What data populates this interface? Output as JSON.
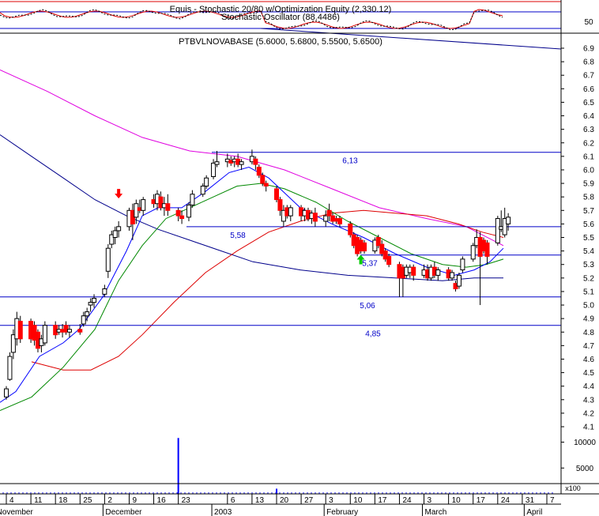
{
  "colors": {
    "background": "#ffffff",
    "axis": "#000000",
    "level_line": "#0000c8",
    "level_label": "#0000c8",
    "price_line": "#00008b",
    "ma_magenta": "#e000e0",
    "ma_red": "#dd0000",
    "ma_green": "#008800",
    "ma_blue": "#0000ff",
    "candle_up": "#ffffff",
    "candle_down": "#ff0000",
    "signal_sell": "#ff0000",
    "signal_buy": "#00cc00",
    "volume": "#0000ff"
  },
  "stochastic_panel": {
    "title_line1": "Equis - Stochastic 20/80  w/Optimization Equity (2,330.12)",
    "title_line2": "Stochastic Oscillator (88.4486)",
    "axis_label": "50"
  },
  "price_panel": {
    "title": "PTBVLNOVABASE (5.6000, 5.6800, 5.5500, 5.6500)",
    "y_ticks": [
      "6.9",
      "6.8",
      "6.7",
      "6.6",
      "6.5",
      "6.4",
      "6.3",
      "6.2",
      "6.1",
      "6.0",
      "5.9",
      "5.8",
      "5.7",
      "5.6",
      "5.5",
      "5.4",
      "5.3",
      "5.2",
      "5.1",
      "5.0",
      "4.9",
      "4.8",
      "4.7",
      "4.6",
      "4.5",
      "4.4",
      "4.3",
      "4.2",
      "4.1"
    ]
  },
  "volume_panel": {
    "y_ticks": [
      "10000",
      "5000"
    ],
    "multiplier_label": "x100"
  },
  "x_axis": {
    "day_ticks": [
      "4",
      "11",
      "18",
      "25",
      "2",
      "9",
      "16",
      "23",
      "6",
      "13",
      "20",
      "27",
      "3",
      "10",
      "17",
      "24",
      "3",
      "10",
      "17",
      "24",
      "31",
      "7"
    ],
    "month_labels": [
      "November",
      "December",
      "2003",
      "February",
      "March",
      "April"
    ]
  },
  "chart_data": {
    "type": "line",
    "title": "PTBVLNOVABASE (5.6000, 5.6800, 5.5500, 5.6500)",
    "ylim": [
      4.1,
      6.9
    ],
    "grid": false,
    "levels": [
      {
        "label": "6,13",
        "value": 6.13
      },
      {
        "label": "5,58",
        "value": 5.58
      },
      {
        "label": "5,37",
        "value": 5.37
      },
      {
        "label": "5,06",
        "value": 5.06
      },
      {
        "label": "4,85",
        "value": 4.85
      }
    ],
    "candles": [
      {
        "date": "2002-11-01",
        "open": 4.28,
        "high": 4.32,
        "low": 4.22,
        "close": 4.3
      },
      {
        "date": "2002-11-04",
        "open": 4.32,
        "high": 4.4,
        "low": 4.3,
        "close": 4.38
      },
      {
        "date": "2002-11-05",
        "open": 4.45,
        "high": 4.65,
        "low": 4.44,
        "close": 4.62
      },
      {
        "date": "2002-11-06",
        "open": 4.65,
        "high": 4.82,
        "low": 4.6,
        "close": 4.78
      },
      {
        "date": "2002-11-07",
        "open": 4.75,
        "high": 4.95,
        "low": 4.7,
        "close": 4.9
      },
      {
        "date": "2002-11-08",
        "open": 4.88,
        "high": 4.92,
        "low": 4.72,
        "close": 4.75
      },
      {
        "date": "2002-11-11",
        "open": 4.88,
        "high": 4.9,
        "low": 4.72,
        "close": 4.75
      },
      {
        "date": "2002-11-12",
        "open": 4.85,
        "high": 4.88,
        "low": 4.7,
        "close": 4.74
      },
      {
        "date": "2002-11-13",
        "open": 4.8,
        "high": 4.82,
        "low": 4.65,
        "close": 4.68
      },
      {
        "date": "2002-11-14",
        "open": 4.7,
        "high": 4.78,
        "low": 4.65,
        "close": 4.75
      },
      {
        "date": "2002-11-15",
        "open": 4.72,
        "high": 4.88,
        "low": 4.7,
        "close": 4.85
      },
      {
        "date": "2002-11-18",
        "open": 4.85,
        "high": 4.88,
        "low": 4.75,
        "close": 4.78
      },
      {
        "date": "2002-11-19",
        "open": 4.8,
        "high": 4.85,
        "low": 4.78,
        "close": 4.82
      },
      {
        "date": "2002-11-20",
        "open": 4.82,
        "high": 4.86,
        "low": 4.76,
        "close": 4.8
      },
      {
        "date": "2002-11-21",
        "open": 4.85,
        "high": 4.88,
        "low": 4.78,
        "close": 4.8
      },
      {
        "date": "2002-11-22",
        "open": 4.8,
        "high": 4.85,
        "low": 4.76,
        "close": 4.82
      },
      {
        "date": "2002-11-25",
        "open": 4.82,
        "high": 4.86,
        "low": 4.78,
        "close": 4.8
      },
      {
        "date": "2002-11-26",
        "open": 4.86,
        "high": 4.95,
        "low": 4.84,
        "close": 4.92
      },
      {
        "date": "2002-11-27",
        "open": 4.92,
        "high": 4.98,
        "low": 4.88,
        "close": 4.95
      },
      {
        "date": "2002-11-28",
        "open": 5.0,
        "high": 5.05,
        "low": 4.95,
        "close": 5.02
      },
      {
        "date": "2002-11-29",
        "open": 5.02,
        "high": 5.08,
        "low": 4.98,
        "close": 5.05
      },
      {
        "date": "2002-12-02",
        "open": 5.08,
        "high": 5.15,
        "low": 5.06,
        "close": 5.12
      },
      {
        "date": "2002-12-03",
        "open": 5.25,
        "high": 5.45,
        "low": 5.2,
        "close": 5.42
      },
      {
        "date": "2002-12-04",
        "open": 5.45,
        "high": 5.55,
        "low": 5.42,
        "close": 5.52
      },
      {
        "date": "2002-12-05",
        "open": 5.5,
        "high": 5.58,
        "low": 5.45,
        "close": 5.55
      },
      {
        "date": "2002-12-06",
        "open": 5.55,
        "high": 5.62,
        "low": 5.5,
        "close": 5.58
      },
      {
        "date": "2002-12-09",
        "open": 5.58,
        "high": 5.72,
        "low": 5.55,
        "close": 5.7
      },
      {
        "date": "2002-12-10",
        "open": 5.7,
        "high": 5.75,
        "low": 5.48,
        "close": 5.6
      },
      {
        "date": "2002-12-11",
        "open": 5.65,
        "high": 5.78,
        "low": 5.6,
        "close": 5.75
      },
      {
        "date": "2002-12-12",
        "open": 5.72,
        "high": 5.78,
        "low": 5.68,
        "close": 5.7
      },
      {
        "date": "2002-12-13",
        "open": 5.7,
        "high": 5.8,
        "low": 5.66,
        "close": 5.78
      },
      {
        "date": "2002-12-16",
        "open": 5.78,
        "high": 5.82,
        "low": 5.72,
        "close": 5.75
      },
      {
        "date": "2002-12-17",
        "open": 5.75,
        "high": 5.85,
        "low": 5.7,
        "close": 5.82
      },
      {
        "date": "2002-12-18",
        "open": 5.8,
        "high": 5.84,
        "low": 5.7,
        "close": 5.72
      },
      {
        "date": "2002-12-19",
        "open": 5.72,
        "high": 5.8,
        "low": 5.66,
        "close": 5.75
      },
      {
        "date": "2002-12-20",
        "open": 5.75,
        "high": 5.82,
        "low": 5.66,
        "close": 5.7
      },
      {
        "date": "2002-12-23",
        "open": 5.7,
        "high": 5.72,
        "low": 5.62,
        "close": 5.66
      },
      {
        "date": "2002-12-24",
        "open": 5.66,
        "high": 5.7,
        "low": 5.6,
        "close": 5.64
      },
      {
        "date": "2002-12-26",
        "open": 5.65,
        "high": 5.76,
        "low": 5.62,
        "close": 5.74
      },
      {
        "date": "2002-12-27",
        "open": 5.74,
        "high": 5.85,
        "low": 5.72,
        "close": 5.82
      },
      {
        "date": "2002-12-30",
        "open": 5.82,
        "high": 5.9,
        "low": 5.8,
        "close": 5.88
      },
      {
        "date": "2002-12-31",
        "open": 5.88,
        "high": 5.96,
        "low": 5.86,
        "close": 5.94
      },
      {
        "date": "2003-01-02",
        "open": 5.95,
        "high": 6.08,
        "low": 5.93,
        "close": 6.05
      },
      {
        "date": "2003-01-03",
        "open": 6.04,
        "high": 6.14,
        "low": 6.02,
        "close": 6.06
      },
      {
        "date": "2003-01-06",
        "open": 6.06,
        "high": 6.12,
        "low": 6.02,
        "close": 6.08
      },
      {
        "date": "2003-01-07",
        "open": 6.07,
        "high": 6.1,
        "low": 6.03,
        "close": 6.05
      },
      {
        "date": "2003-01-08",
        "open": 6.06,
        "high": 6.1,
        "low": 6.02,
        "close": 6.08
      },
      {
        "date": "2003-01-09",
        "open": 6.08,
        "high": 6.12,
        "low": 6.02,
        "close": 6.04
      },
      {
        "date": "2003-01-10",
        "open": 6.04,
        "high": 6.08,
        "low": 6.0,
        "close": 6.06
      },
      {
        "date": "2003-01-13",
        "open": 6.06,
        "high": 6.15,
        "low": 6.04,
        "close": 6.1
      },
      {
        "date": "2003-01-14",
        "open": 6.08,
        "high": 6.1,
        "low": 6.0,
        "close": 6.04
      },
      {
        "date": "2003-01-15",
        "open": 6.02,
        "high": 6.04,
        "low": 5.94,
        "close": 5.96
      },
      {
        "date": "2003-01-16",
        "open": 5.96,
        "high": 5.98,
        "low": 5.88,
        "close": 5.9
      },
      {
        "date": "2003-01-17",
        "open": 5.9,
        "high": 5.92,
        "low": 5.84,
        "close": 5.88
      },
      {
        "date": "2003-01-20",
        "open": 5.86,
        "high": 5.88,
        "low": 5.76,
        "close": 5.78
      },
      {
        "date": "2003-01-21",
        "open": 5.78,
        "high": 5.8,
        "low": 5.66,
        "close": 5.7
      },
      {
        "date": "2003-01-22",
        "open": 5.62,
        "high": 5.74,
        "low": 5.58,
        "close": 5.7
      },
      {
        "date": "2003-01-23",
        "open": 5.72,
        "high": 5.74,
        "low": 5.64,
        "close": 5.66
      },
      {
        "date": "2003-01-24",
        "open": 5.66,
        "high": 5.74,
        "low": 5.62,
        "close": 5.72
      },
      {
        "date": "2003-01-27",
        "open": 5.72,
        "high": 5.74,
        "low": 5.62,
        "close": 5.66
      },
      {
        "date": "2003-01-28",
        "open": 5.66,
        "high": 5.72,
        "low": 5.62,
        "close": 5.7
      },
      {
        "date": "2003-01-29",
        "open": 5.7,
        "high": 5.72,
        "low": 5.62,
        "close": 5.64
      },
      {
        "date": "2003-01-30",
        "open": 5.64,
        "high": 5.7,
        "low": 5.6,
        "close": 5.68
      },
      {
        "date": "2003-01-31",
        "open": 5.68,
        "high": 5.72,
        "low": 5.58,
        "close": 5.62
      },
      {
        "date": "2003-02-03",
        "open": 5.62,
        "high": 5.7,
        "low": 5.58,
        "close": 5.66
      },
      {
        "date": "2003-02-04",
        "open": 5.7,
        "high": 5.75,
        "low": 5.62,
        "close": 5.66
      },
      {
        "date": "2003-02-05",
        "open": 5.66,
        "high": 5.68,
        "low": 5.6,
        "close": 5.62
      },
      {
        "date": "2003-02-06",
        "open": 5.64,
        "high": 5.66,
        "low": 5.6,
        "close": 5.62
      },
      {
        "date": "2003-02-07",
        "open": 5.64,
        "high": 5.66,
        "low": 5.58,
        "close": 5.6
      },
      {
        "date": "2003-02-10",
        "open": 5.6,
        "high": 5.62,
        "low": 5.5,
        "close": 5.52
      },
      {
        "date": "2003-02-11",
        "open": 5.52,
        "high": 5.54,
        "low": 5.42,
        "close": 5.44
      },
      {
        "date": "2003-02-12",
        "open": 5.5,
        "high": 5.52,
        "low": 5.36,
        "close": 5.38
      },
      {
        "date": "2003-02-13",
        "open": 5.48,
        "high": 5.5,
        "low": 5.38,
        "close": 5.4
      },
      {
        "date": "2003-02-14",
        "open": 5.46,
        "high": 5.48,
        "low": 5.38,
        "close": 5.4
      },
      {
        "date": "2003-02-17",
        "open": 5.4,
        "high": 5.5,
        "low": 5.38,
        "close": 5.48
      },
      {
        "date": "2003-02-18",
        "open": 5.5,
        "high": 5.52,
        "low": 5.42,
        "close": 5.44
      },
      {
        "date": "2003-02-19",
        "open": 5.45,
        "high": 5.48,
        "low": 5.36,
        "close": 5.38
      },
      {
        "date": "2003-02-20",
        "open": 5.4,
        "high": 5.42,
        "low": 5.32,
        "close": 5.34
      },
      {
        "date": "2003-02-21",
        "open": 5.36,
        "high": 5.38,
        "low": 5.28,
        "close": 5.3
      },
      {
        "date": "2003-02-24",
        "open": 5.3,
        "high": 5.32,
        "low": 5.06,
        "close": 5.2
      },
      {
        "date": "2003-02-25",
        "open": 5.28,
        "high": 5.3,
        "low": 5.06,
        "close": 5.2
      },
      {
        "date": "2003-02-26",
        "open": 5.22,
        "high": 5.3,
        "low": 5.2,
        "close": 5.28
      },
      {
        "date": "2003-02-27",
        "open": 5.24,
        "high": 5.3,
        "low": 5.2,
        "close": 5.28
      },
      {
        "date": "2003-02-28",
        "open": 5.28,
        "high": 5.3,
        "low": 5.18,
        "close": 5.22
      },
      {
        "date": "2003-03-03",
        "open": 5.22,
        "high": 5.3,
        "low": 5.2,
        "close": 5.26
      },
      {
        "date": "2003-03-04",
        "open": 5.26,
        "high": 5.3,
        "low": 5.18,
        "close": 5.2
      },
      {
        "date": "2003-03-05",
        "open": 5.2,
        "high": 5.3,
        "low": 5.18,
        "close": 5.28
      },
      {
        "date": "2003-03-06",
        "open": 5.28,
        "high": 5.32,
        "low": 5.2,
        "close": 5.22
      },
      {
        "date": "2003-03-07",
        "open": 5.22,
        "high": 5.28,
        "low": 5.18,
        "close": 5.26
      },
      {
        "date": "2003-03-10",
        "open": 5.26,
        "high": 5.28,
        "low": 5.18,
        "close": 5.2
      },
      {
        "date": "2003-03-11",
        "open": 5.2,
        "high": 5.26,
        "low": 5.18,
        "close": 5.24
      },
      {
        "date": "2003-03-12",
        "open": 5.16,
        "high": 5.18,
        "low": 5.1,
        "close": 5.12
      },
      {
        "date": "2003-03-13",
        "open": 5.14,
        "high": 5.24,
        "low": 5.12,
        "close": 5.22
      },
      {
        "date": "2003-03-14",
        "open": 5.26,
        "high": 5.36,
        "low": 5.24,
        "close": 5.34
      },
      {
        "date": "2003-03-17",
        "open": 5.34,
        "high": 5.46,
        "low": 5.32,
        "close": 5.44
      },
      {
        "date": "2003-03-18",
        "open": 5.44,
        "high": 5.56,
        "low": 5.42,
        "close": 5.5
      },
      {
        "date": "2003-03-19",
        "open": 5.5,
        "high": 5.54,
        "low": 5.0,
        "close": 5.36
      },
      {
        "date": "2003-03-20",
        "open": 5.48,
        "high": 5.5,
        "low": 5.38,
        "close": 5.4
      },
      {
        "date": "2003-03-21",
        "open": 5.46,
        "high": 5.48,
        "low": 5.3,
        "close": 5.36
      },
      {
        "date": "2003-03-24",
        "open": 5.46,
        "high": 5.66,
        "low": 5.44,
        "close": 5.64
      },
      {
        "date": "2003-03-25",
        "open": 5.56,
        "high": 5.7,
        "low": 5.54,
        "close": 5.58
      },
      {
        "date": "2003-03-26",
        "open": 5.52,
        "high": 5.72,
        "low": 5.5,
        "close": 5.64
      },
      {
        "date": "2003-03-27",
        "open": 5.6,
        "high": 5.68,
        "low": 5.55,
        "close": 5.65
      }
    ],
    "signals": [
      {
        "type": "sell",
        "date": "2002-12-06",
        "price": 5.8
      },
      {
        "type": "buy",
        "date": "2003-02-13",
        "price": 5.36
      }
    ],
    "volume": [
      {
        "date": "2002-12-23",
        "value": 10800
      },
      {
        "date": "2003-01-20",
        "value": 1000
      }
    ],
    "volume_ylim": [
      0,
      11000
    ]
  }
}
